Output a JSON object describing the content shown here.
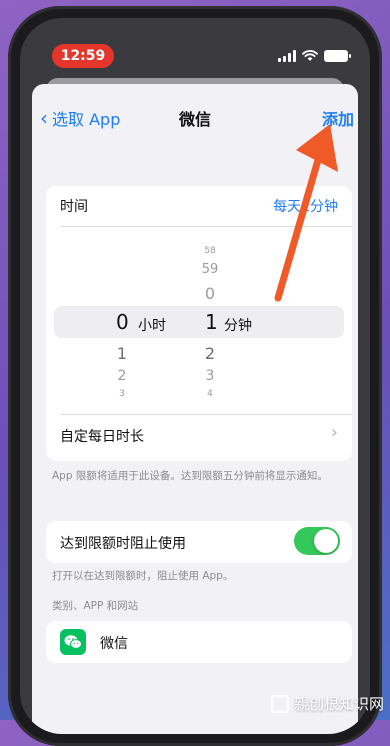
{
  "status": {
    "time": "12:59"
  },
  "nav": {
    "back_label": "选取 App",
    "title": "微信",
    "add_label": "添加"
  },
  "time_row": {
    "label": "时间",
    "value": "每天1分钟"
  },
  "picker": {
    "hours": {
      "above": [
        "",
        "",
        ""
      ],
      "selected": "0",
      "unit": "小时",
      "below": [
        "1",
        "2",
        "3"
      ]
    },
    "minutes": {
      "above": [
        "58",
        "59",
        "0"
      ],
      "selected": "1",
      "unit": "分钟",
      "below": [
        "2",
        "3",
        "4"
      ]
    }
  },
  "custom_row": {
    "label": "自定每日时长"
  },
  "note_limit": "App 限额将适用于此设备。达到限额五分钟前将显示通知。",
  "block_row": {
    "label": "达到限额时阻止使用",
    "toggle_on": true
  },
  "note_block": "打开以在达到限额时，阻止使用 App。",
  "section_header": "类别、APP 和网站",
  "app_row": {
    "name": "微信",
    "icon": "wechat-icon"
  },
  "watermark": "親创根知识网",
  "colors": {
    "accent": "#1e7df6",
    "toggle_on": "#34c759",
    "annotation": "#f05a28",
    "time_pill": "#e5362c"
  }
}
